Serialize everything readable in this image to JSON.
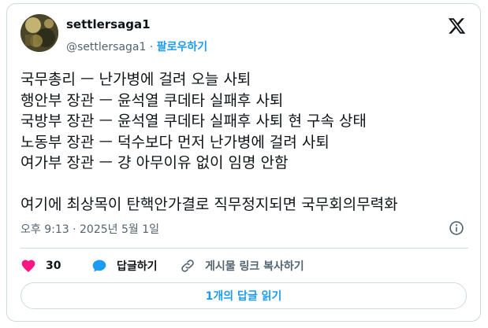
{
  "author": {
    "display_name": "settlersaga1",
    "handle": "@settlersaga1",
    "separator": "·",
    "follow_label": "팔로우하기"
  },
  "tweet": {
    "text": "국무총리 ㅡ 난가병에 걸려 오늘 사퇴\n행안부 장관 ㅡ 윤석열 쿠데타 실패후 사퇴\n국방부 장관 ㅡ 윤석열 쿠데타 실패후 사퇴 현 구속 상태\n노동부 장관 ㅡ 덕수보다 먼저 난가병에 걸려 사퇴\n여가부 장관 ㅡ 걍 아무이유 없이 임명 안함\n\n여기에 최상목이 탄핵안가결로 직무정지되면 국무회의무력화",
    "timestamp": "오후 9:13 · 2025년 5월 1일"
  },
  "actions": {
    "like_count": "30",
    "reply_label": "답글하기",
    "copy_link_label": "게시물 링크 복사하기"
  },
  "replies_button_label": "1개의 답글 읽기",
  "colors": {
    "accent": "#1d9bf0",
    "like": "#f91880",
    "text": "#0f1419",
    "muted": "#536471",
    "border": "#cfd9de"
  },
  "icons": {
    "logo": "x-logo-icon",
    "info": "info-icon",
    "like": "heart-icon",
    "reply": "speech-bubble-icon",
    "copy": "link-icon"
  }
}
